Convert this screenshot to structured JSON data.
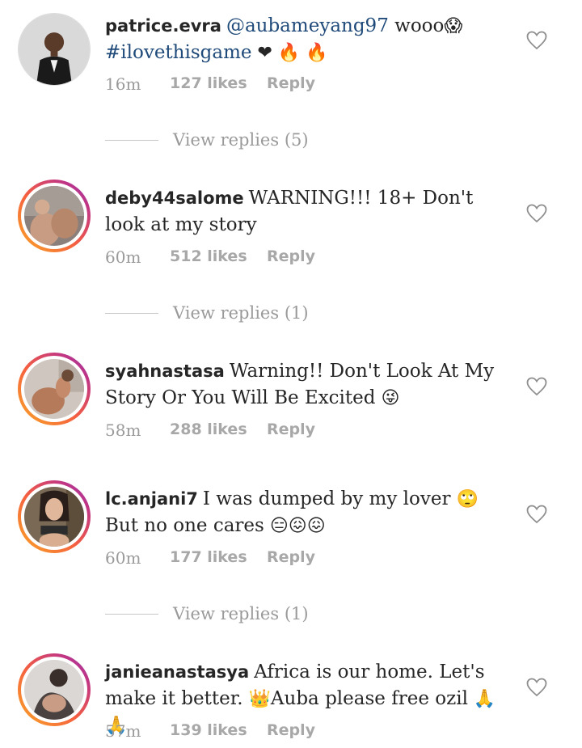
{
  "comments": [
    {
      "username": "patrice.evra",
      "mention": "@aubameyang97",
      "text": " wooo",
      "emoji1": "😱",
      "line2": "#ilovethisgame",
      "emoji2": " ❤ 🔥 🔥",
      "time": "16m",
      "likes": "127 likes",
      "reply": "Reply",
      "view_replies": "View replies (5)"
    },
    {
      "username": "deby44salome",
      "text": "WARNING!!! 18+ Don't look at my story",
      "time": "60m",
      "likes": "512 likes",
      "reply": "Reply",
      "view_replies": "View replies (1)"
    },
    {
      "username": "syahnastasa",
      "text": "Warning!! Don't Look At My Story Or You Will Be Excited",
      "emoji": " 😜",
      "time": "58m",
      "likes": "288 likes",
      "reply": "Reply"
    },
    {
      "username": "lc.anjani7",
      "text": "I was dumped by my lover",
      "emoji": " 🙄",
      "line2": "But no one cares",
      "emoji2": " 😑😖😖",
      "time": "60m",
      "likes": "177 likes",
      "reply": "Reply",
      "view_replies": "View replies (1)"
    },
    {
      "username": "janieanastasya",
      "text": "Africa is our home. Let's make it better.",
      "emoji": " 👑",
      "text2": "Auba please free ozil",
      "emoji2": " 🙏🙏",
      "time": "57m",
      "likes": "139 likes",
      "reply": "Reply"
    }
  ],
  "icons": {
    "like": "heart-outline-icon"
  },
  "colors": {
    "link": "#1f4a7a",
    "muted": "#9a9a9a"
  }
}
